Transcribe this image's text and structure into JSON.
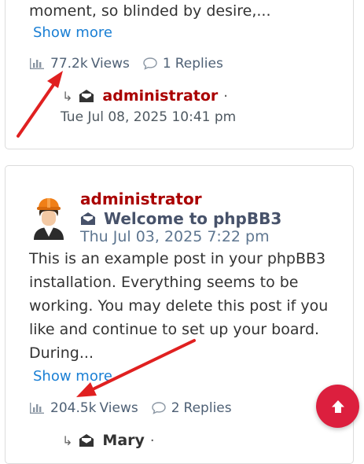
{
  "post1": {
    "excerpt_tail": "moment, so blinded by desire,...",
    "show_more": "Show more",
    "views_count": "77.2k",
    "views_label": "Views",
    "replies_count": "1",
    "replies_label": "Replies",
    "last_author": "administrator",
    "separator": "·",
    "last_date": "Tue Jul 08, 2025 10:41 pm"
  },
  "post2": {
    "author": "administrator",
    "title": "Welcome to phpBB3",
    "date": "Thu Jul 03, 2025 7:22 pm",
    "excerpt": "This is an example post in your phpBB3 installation. Everything seems to be working. You may delete this post if you like and continue to set up your board. During...",
    "show_more": "Show more",
    "views_count": "204.5k",
    "views_label": "Views",
    "replies_count": "2",
    "replies_label": "Replies",
    "last_author": "Mary",
    "separator": "·"
  },
  "icons": {
    "views": "bar-chart-icon",
    "replies": "comment-icon",
    "topic": "envelope-open-icon",
    "reply": "reply-arrow-icon",
    "scroll_top": "arrow-up-icon"
  },
  "colors": {
    "author": "#aa0000",
    "link": "#1a7fd4",
    "meta": "#4e6075",
    "annotation_arrow": "#e02020",
    "scroll_top_button": "#dc1f3e"
  }
}
